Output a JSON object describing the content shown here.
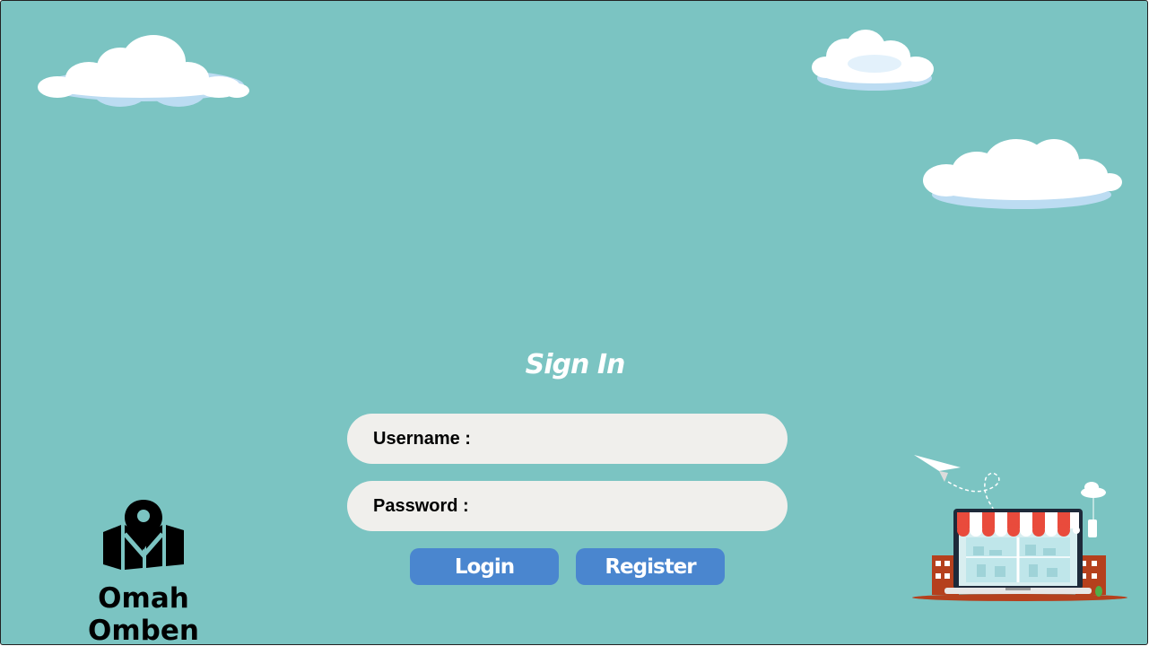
{
  "signin": {
    "title": "Sign In",
    "username_label": "Username  :",
    "username_value": "",
    "password_label": "Password  :",
    "password_value": "",
    "login_label": "Login",
    "register_label": "Register"
  },
  "brand": {
    "name": "Omah  Omben",
    "icon": "map-pin-icon"
  },
  "colors": {
    "background": "#7bc4c2",
    "field": "#f0efec",
    "button": "#4a86cf",
    "title": "#ffffff"
  }
}
